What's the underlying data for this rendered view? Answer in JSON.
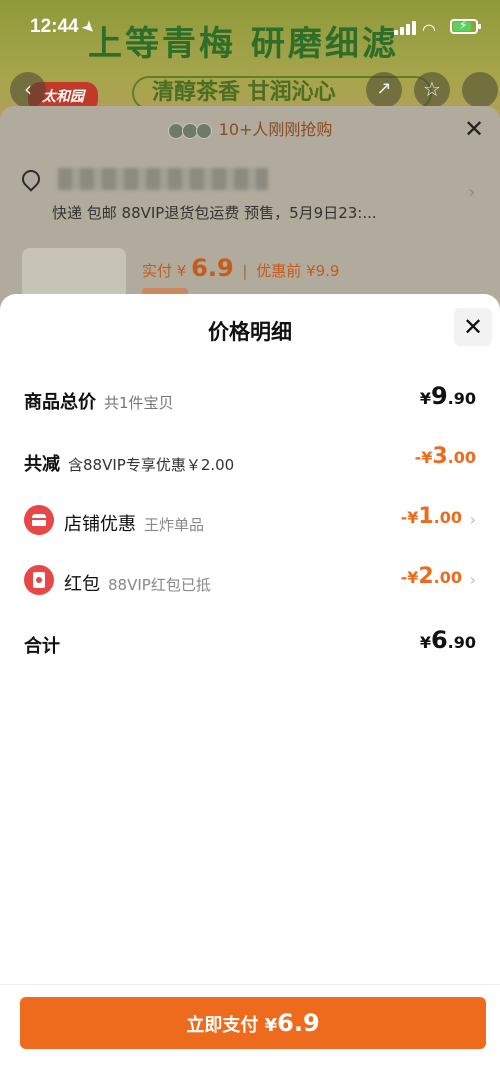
{
  "status_bar": {
    "time": "12:44"
  },
  "background": {
    "banner_title": "上等青梅 研磨细滤",
    "banner_slogan": "清醇茶香 甘润沁心",
    "brand_logo": "太和园",
    "recent_buyers": "10+人刚刚抢购",
    "shipping_info": "快递 包邮 88VIP退货包运费 预售，5月9日23:...",
    "pay_label": "实付",
    "pay_currency": "¥",
    "pay_value": "6.9",
    "pre_discount_label": "优惠前",
    "pre_discount_value": "¥9.9"
  },
  "sheet": {
    "title": "价格明细",
    "rows": {
      "total": {
        "label": "商品总价",
        "sub": "共1件宝贝",
        "currency": "¥",
        "int": "9",
        "dec": ".90"
      },
      "reduce": {
        "label": "共减",
        "sub": "含88VIP专享优惠￥2.00",
        "prefix": "-¥",
        "int": "3",
        "dec": ".00"
      },
      "shop": {
        "label": "店铺优惠",
        "sub": "王炸单品",
        "prefix": "-¥",
        "int": "1",
        "dec": ".00"
      },
      "redpacket": {
        "label": "红包",
        "sub": "88VIP红包已抵",
        "prefix": "-¥",
        "int": "2",
        "dec": ".00"
      },
      "sum": {
        "label": "合计",
        "currency": "¥",
        "int": "6",
        "dec": ".90"
      }
    },
    "pay_button": {
      "label": "立即支付",
      "currency": "¥",
      "value": "6.9"
    }
  },
  "colors": {
    "accent": "#ee6a1c",
    "icon_red": "#e84747"
  }
}
